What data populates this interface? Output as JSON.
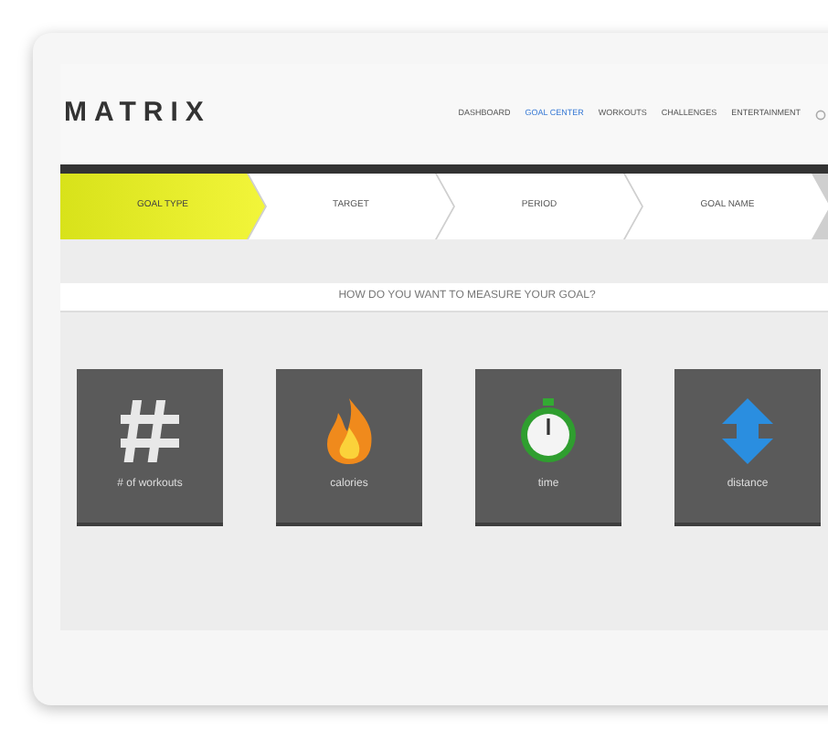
{
  "logo": "MATRIX",
  "nav": [
    {
      "label": "DASHBOARD",
      "selected": false
    },
    {
      "label": "GOAL CENTER",
      "selected": true
    },
    {
      "label": "WORKOUTS",
      "selected": false
    },
    {
      "label": "CHALLENGES",
      "selected": false
    },
    {
      "label": "ENTERTAINMENT",
      "selected": false
    }
  ],
  "steps": [
    {
      "label": "GOAL TYPE",
      "selected": true
    },
    {
      "label": "TARGET",
      "selected": false
    },
    {
      "label": "PERIOD",
      "selected": false
    },
    {
      "label": "GOAL NAME",
      "selected": false
    }
  ],
  "question": "HOW DO YOU WANT TO MEASURE YOUR GOAL?",
  "tiles": [
    {
      "label": "# of workouts",
      "kind": "count"
    },
    {
      "label": "calories",
      "kind": "flame"
    },
    {
      "label": "time",
      "kind": "stopwatch"
    },
    {
      "label": "distance",
      "kind": "arrows"
    }
  ]
}
